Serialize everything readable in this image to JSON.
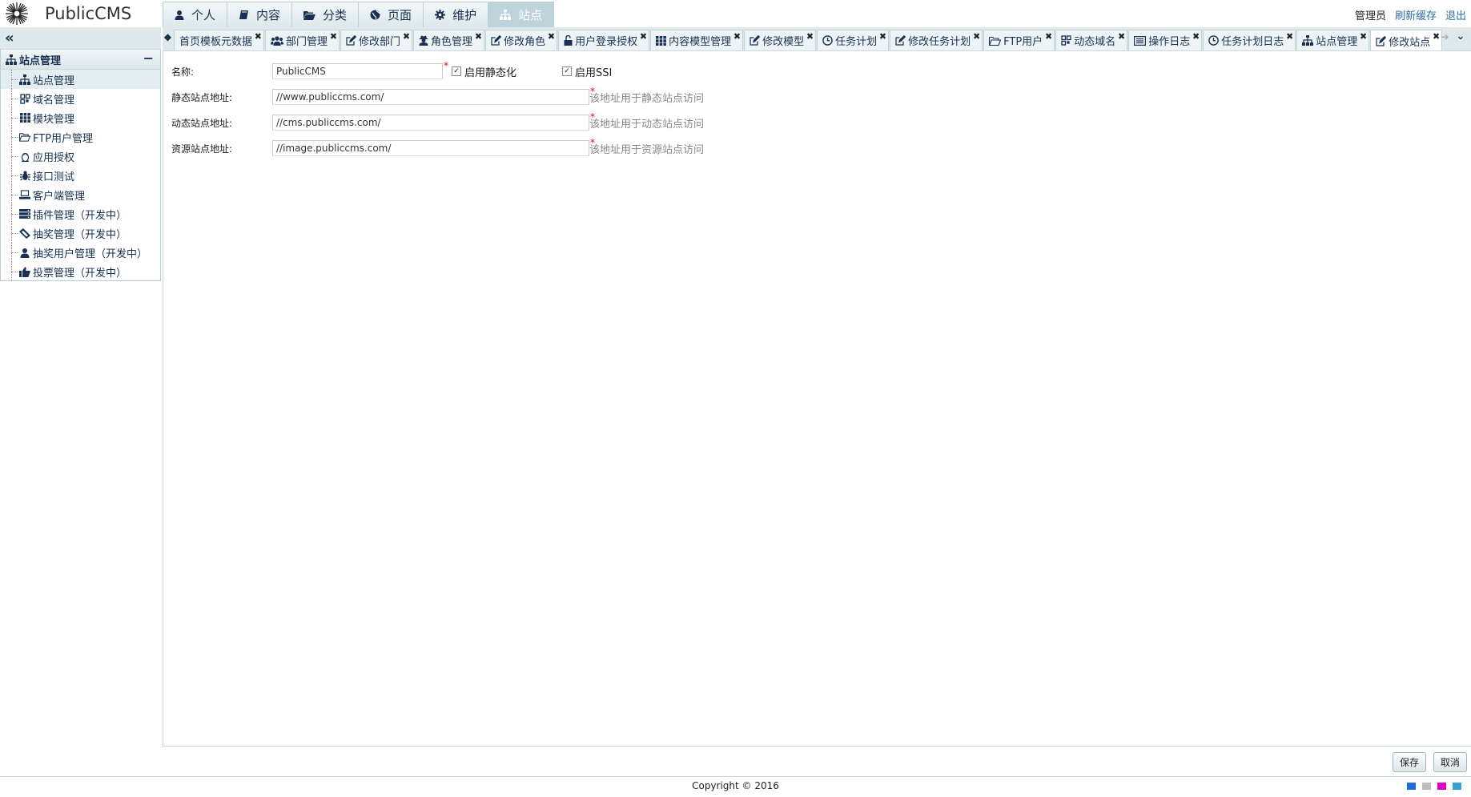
{
  "header": {
    "logo_text": "PublicCMS",
    "menu": [
      {
        "label": "个人",
        "icon": "user-icon",
        "active": false
      },
      {
        "label": "内容",
        "icon": "book-icon",
        "active": false
      },
      {
        "label": "分类",
        "icon": "folder-open-icon",
        "active": false
      },
      {
        "label": "页面",
        "icon": "globe-icon",
        "active": false
      },
      {
        "label": "维护",
        "icon": "gear-icon",
        "active": false
      },
      {
        "label": "站点",
        "icon": "sitemap-icon",
        "active": true
      }
    ],
    "user": "管理员",
    "refresh_cache": "刷新缓存",
    "logout": "退出"
  },
  "sidebar": {
    "collapse_icon": "double-chevron-left-icon",
    "panel_title": "站点管理",
    "items": [
      {
        "label": "站点管理",
        "icon": "sitemap-icon",
        "selected": true
      },
      {
        "label": "域名管理",
        "icon": "qrcode-icon"
      },
      {
        "label": "模块管理",
        "icon": "grid-icon"
      },
      {
        "label": "FTP用户管理",
        "icon": "folder-icon"
      },
      {
        "label": "应用授权",
        "icon": "linux-icon"
      },
      {
        "label": "接口测试",
        "icon": "bug-icon"
      },
      {
        "label": "客户端管理",
        "icon": "laptop-icon"
      },
      {
        "label": "插件管理（开发中）",
        "icon": "server-icon"
      },
      {
        "label": "抽奖管理（开发中）",
        "icon": "ticket-icon"
      },
      {
        "label": "抽奖用户管理（开发中）",
        "icon": "user-icon"
      },
      {
        "label": "投票管理（开发中）",
        "icon": "thumbs-up-icon"
      }
    ]
  },
  "tabs": [
    {
      "label": "首页模板元数据",
      "icon": ""
    },
    {
      "label": "部门管理",
      "icon": "users-icon"
    },
    {
      "label": "修改部门",
      "icon": "edit-icon"
    },
    {
      "label": "角色管理",
      "icon": "user-secret-icon"
    },
    {
      "label": "修改角色",
      "icon": "edit-icon"
    },
    {
      "label": "用户登录授权",
      "icon": "unlock-icon"
    },
    {
      "label": "内容模型管理",
      "icon": "grid-icon"
    },
    {
      "label": "修改模型",
      "icon": "edit-icon"
    },
    {
      "label": "任务计划",
      "icon": "clock-icon"
    },
    {
      "label": "修改任务计划",
      "icon": "edit-icon"
    },
    {
      "label": "FTP用户",
      "icon": "folder-icon"
    },
    {
      "label": "动态域名",
      "icon": "qrcode-icon"
    },
    {
      "label": "操作日志",
      "icon": "list-icon"
    },
    {
      "label": "任务计划日志",
      "icon": "clock-icon"
    },
    {
      "label": "站点管理",
      "icon": "sitemap-icon"
    },
    {
      "label": "修改站点",
      "icon": "edit-icon",
      "active": true
    }
  ],
  "form": {
    "name_label": "名称:",
    "name_value": "PublicCMS",
    "static_label": "启用静态化",
    "static_checked": true,
    "ssi_label": "启用SSI",
    "ssi_checked": true,
    "static_url_label": "静态站点地址:",
    "static_url_value": "//www.publiccms.com/",
    "static_url_hint": "该地址用于静态站点访问",
    "dynamic_url_label": "动态站点地址:",
    "dynamic_url_value": "//cms.publiccms.com/",
    "dynamic_url_hint": "该地址用于动态站点访问",
    "resource_url_label": "资源站点地址:",
    "resource_url_value": "//image.publiccms.com/",
    "resource_url_hint": "该地址用于资源站点访问",
    "required_mark": "*"
  },
  "actions": {
    "save": "保存",
    "cancel": "取消"
  },
  "footer": {
    "copyright": "Copyright © 2016",
    "theme_colors": [
      "#1e6fd9",
      "#bdbdbd",
      "#e000c8",
      "#3aa0d8"
    ]
  }
}
